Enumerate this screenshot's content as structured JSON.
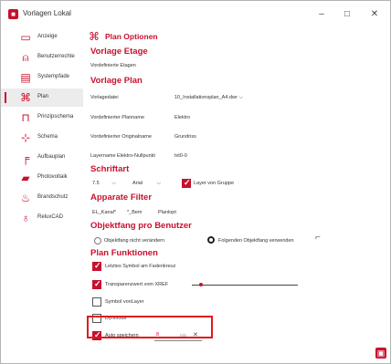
{
  "window": {
    "title": "Vorlagen Lokal",
    "controls": [
      "–",
      "□",
      "✕"
    ]
  },
  "sidebar": {
    "items": [
      {
        "label": "Anzeige",
        "icon": "monitor-icon",
        "glyph": "▭"
      },
      {
        "label": "Benutzerrechte",
        "icon": "user-icon",
        "glyph": "⍝"
      },
      {
        "label": "Systempfade",
        "icon": "folder-icon",
        "glyph": "▤"
      },
      {
        "label": "Plan",
        "icon": "plan-icon",
        "glyph": "⌘",
        "active": true
      },
      {
        "label": "Prinzipschema",
        "icon": "schema-icon",
        "glyph": "⊓"
      },
      {
        "label": "Schema",
        "icon": "schema-tree-icon",
        "glyph": "⊹"
      },
      {
        "label": "Aufbauplan",
        "icon": "aufbauplan-icon",
        "glyph": "╒"
      },
      {
        "label": "Photovoltaik",
        "icon": "photovoltaik-icon",
        "glyph": "▰"
      },
      {
        "label": "Brandschutz",
        "icon": "brandschutz-icon",
        "glyph": "♨"
      },
      {
        "label": "ReluxCAD",
        "icon": "bulb-icon",
        "glyph": "♁"
      }
    ]
  },
  "main": {
    "title": "Plan Optionen",
    "vorlage_etage": {
      "heading": "Vorlage Etage",
      "label": "Vordefinierte Etagen"
    },
    "vorlage_plan": {
      "heading": "Vorlage Plan",
      "rows": [
        {
          "label": "Vorlagedatei",
          "value": "10_Installationsplan_A4.dwr"
        },
        {
          "label": "Vordefinierter Planname",
          "value": "Elektro"
        },
        {
          "label": "Vordefinierter Originalname",
          "value": "Grundriss"
        },
        {
          "label": "Layername Elektro-Nullpunkt",
          "value": "txt0-0"
        }
      ]
    },
    "schriftart": {
      "heading": "Schriftart",
      "size": "7.5",
      "font": "Arial",
      "layer_checkbox_label": "Layer von Gruppe",
      "layer_checked": true
    },
    "apparate_filter": {
      "heading": "Apparate Filter",
      "values": [
        "EL_Kanal*",
        "*_Bem",
        "Planlopt"
      ]
    },
    "objektfang": {
      "heading": "Objektfang pro Benutzer",
      "option_1": "Objektfang nicht verändern",
      "option_2": "Folgenden Objektfang verwenden",
      "selected": "option_2"
    },
    "plan_funktionen": {
      "heading": "Plan Funktionen",
      "items": [
        {
          "label": "Letztes Symbol am Fadenkreuz",
          "checked": true
        },
        {
          "label": "Transparenzwert vom XREF",
          "checked": true,
          "level": 0.09
        },
        {
          "label": "Symbol vonLayer",
          "checked": false
        },
        {
          "label": "Dynmode",
          "checked": false
        },
        {
          "label": "Auto speichern",
          "checked": true,
          "input_value": "8",
          "unit": "Min",
          "clear": "✕"
        }
      ]
    }
  },
  "colors": {
    "accent": "#c8102e",
    "highlight": "#e0191e"
  }
}
